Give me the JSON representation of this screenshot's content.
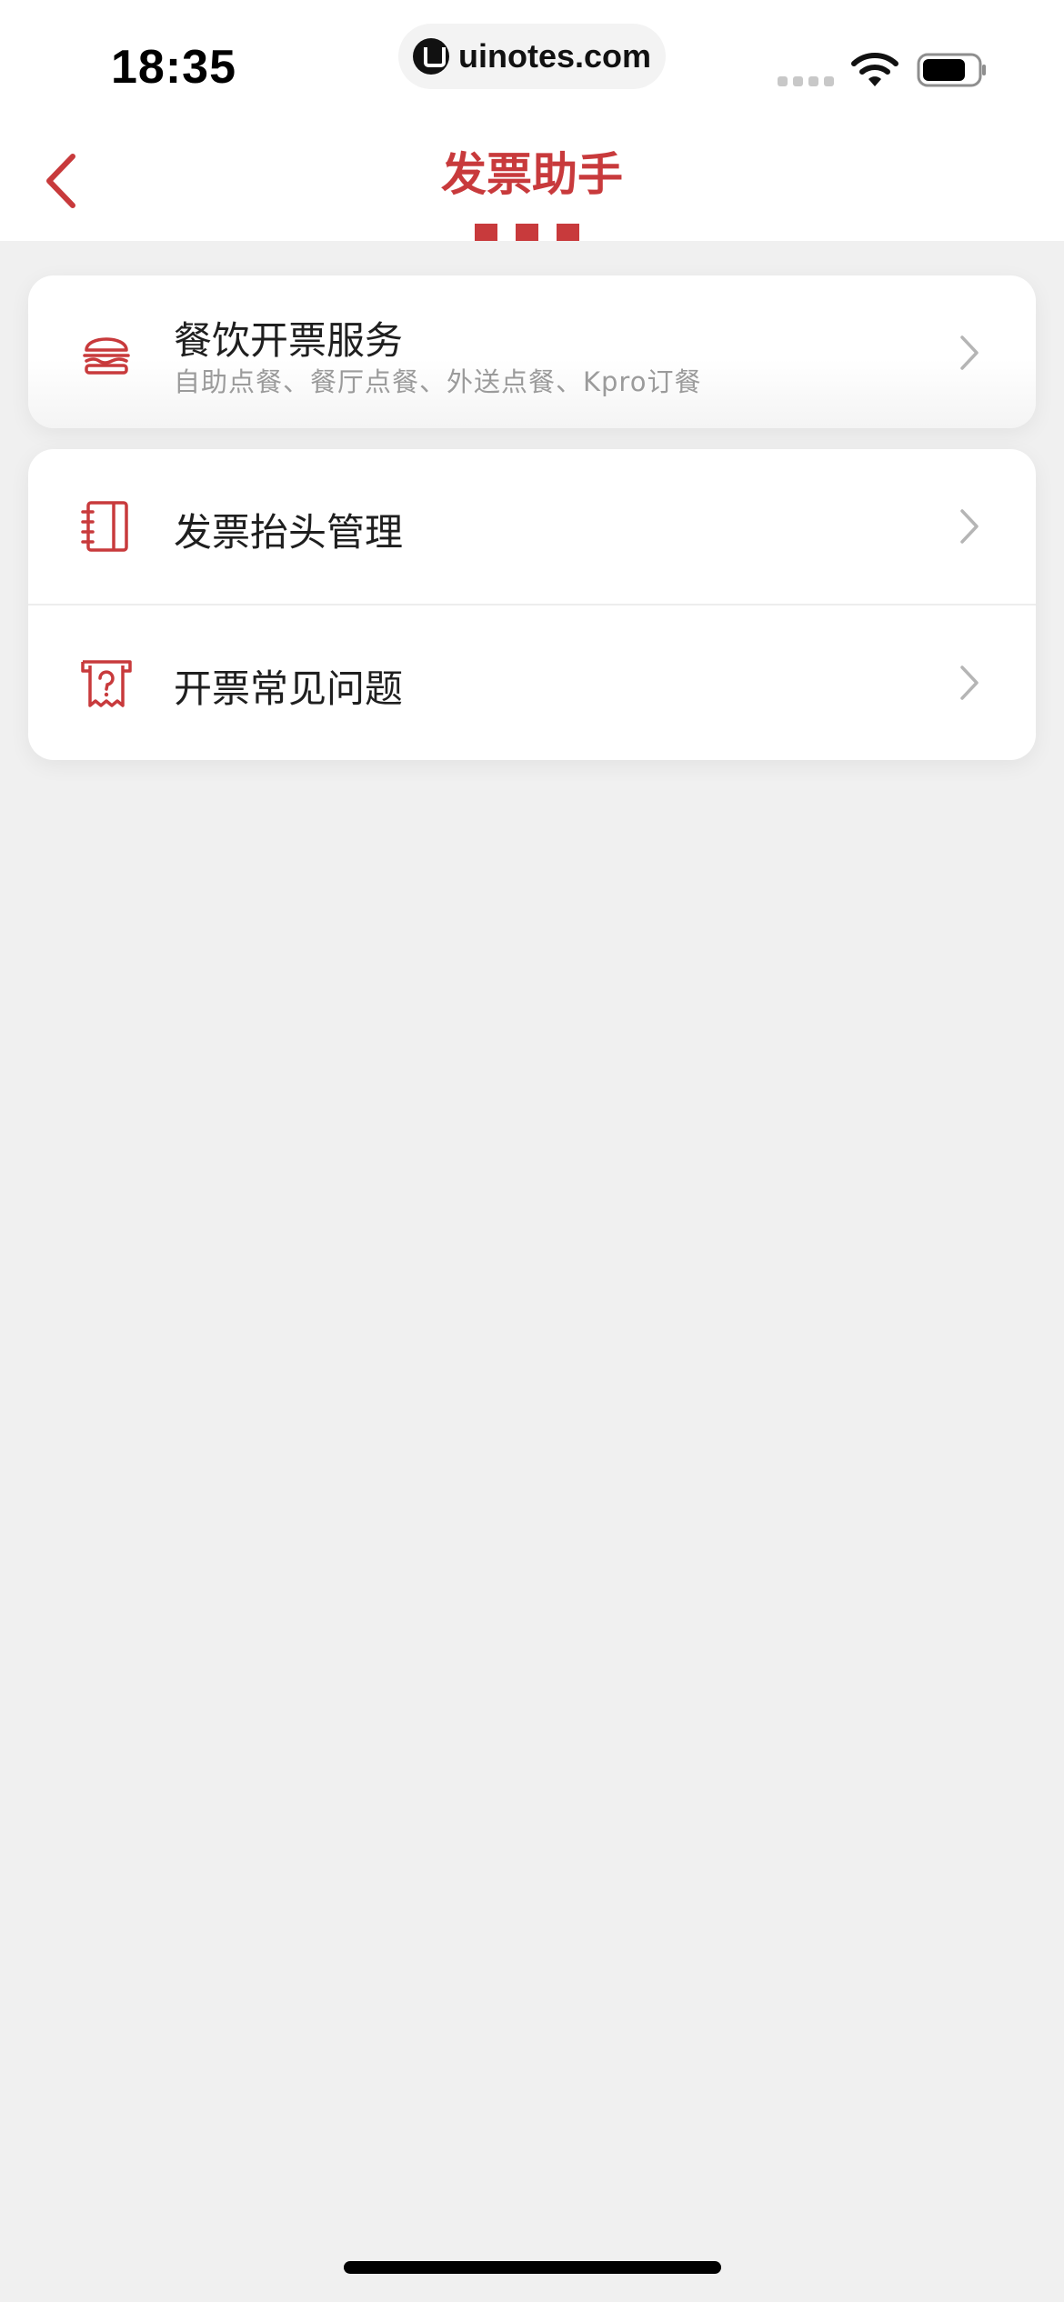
{
  "status_bar": {
    "time": "18:35",
    "url": "uinotes.com",
    "icons": [
      "signal-icon",
      "wifi-icon",
      "battery-icon"
    ]
  },
  "nav": {
    "title": "发票助手",
    "back_icon": "chevron-left-icon"
  },
  "menu": [
    {
      "title": "餐饮开票服务",
      "subtitle": "自助点餐、餐厅点餐、外送点餐、Kpro订餐",
      "icon": "burger-icon"
    },
    {
      "title": "发票抬头管理",
      "icon": "notebook-icon"
    },
    {
      "title": "开票常见问题",
      "icon": "receipt-question-icon"
    }
  ],
  "colors": {
    "accent": "#c83a3c",
    "background": "#f0f0f0",
    "card": "#ffffff",
    "subtitle": "#9b9b9b"
  }
}
